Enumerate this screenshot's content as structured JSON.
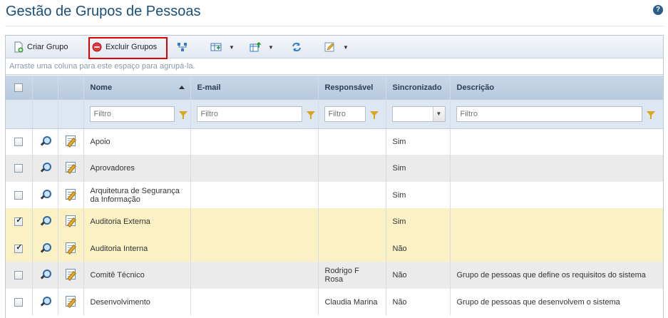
{
  "page": {
    "title": "Gestão de Grupos de Pessoas",
    "help_icon": "?"
  },
  "toolbar": {
    "create_label": "Criar Grupo",
    "delete_label": "Excluir Grupos"
  },
  "group_bar": {
    "text": "Arraste uma coluna para este espaço para agrupá-la."
  },
  "columns": {
    "name": "Nome",
    "email": "E-mail",
    "owner": "Responsável",
    "synced": "Sincronizado",
    "description": "Descrição"
  },
  "filters": {
    "placeholder": "Filtro"
  },
  "rows": [
    {
      "name": "Apoio",
      "email": "",
      "owner": "",
      "synced": "Sim",
      "description": "",
      "checked": false
    },
    {
      "name": "Aprovadores",
      "email": "",
      "owner": "",
      "synced": "Sim",
      "description": "",
      "checked": false
    },
    {
      "name": "Arquitetura de Segurança da Informação",
      "email": "",
      "owner": "",
      "synced": "Sim",
      "description": "",
      "checked": false
    },
    {
      "name": "Auditoria Externa",
      "email": "",
      "owner": "",
      "synced": "Sim",
      "description": "",
      "checked": true
    },
    {
      "name": "Auditoria Interna",
      "email": "",
      "owner": "",
      "synced": "Não",
      "description": "",
      "checked": true
    },
    {
      "name": "Comitê Técnico",
      "email": "",
      "owner": "Rodrigo F Rosa",
      "synced": "Não",
      "description": "Grupo de pessoas que define os requisitos do sistema",
      "checked": false
    },
    {
      "name": "Desenvolvimento",
      "email": "",
      "owner": "Claudia Marina",
      "synced": "Não",
      "description": "Grupo de pessoas que desenvolvem o sistema",
      "checked": false
    }
  ],
  "colors": {
    "title": "#1a4f7a",
    "header_bg": "#c8d7e8",
    "selected_row": "#fbf1c4",
    "alt_row": "#ebebeb",
    "highlight": "#e00000"
  }
}
